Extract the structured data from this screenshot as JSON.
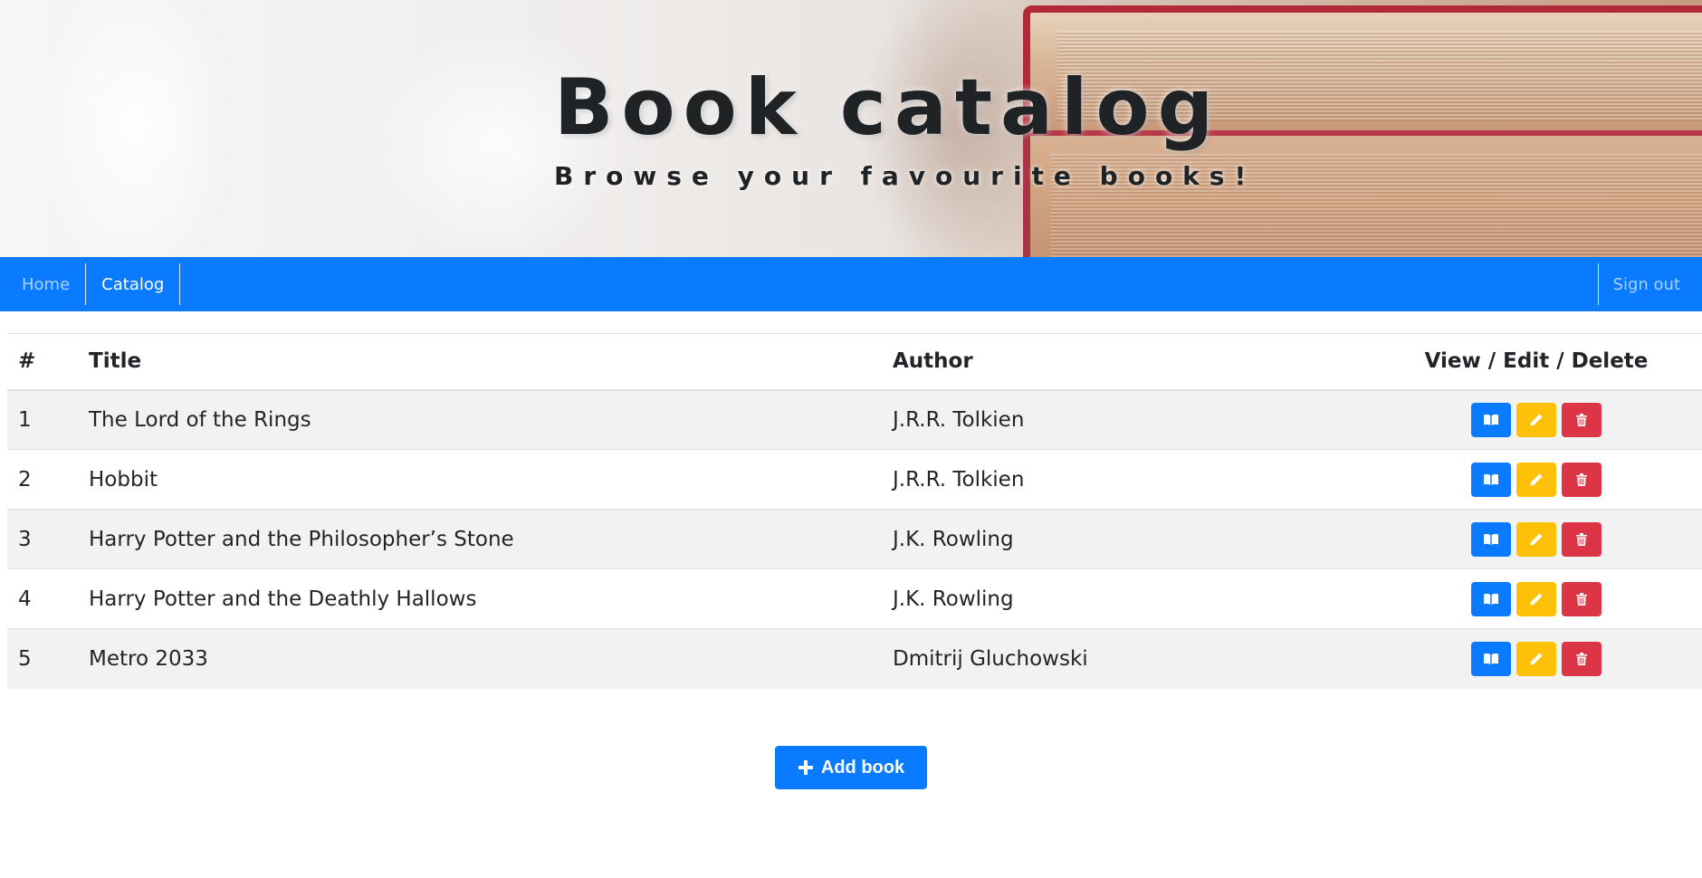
{
  "header": {
    "title": "Book catalog",
    "subtitle": "Browse your favourite books!"
  },
  "nav": {
    "home": "Home",
    "catalog": "Catalog",
    "signout": "Sign out"
  },
  "table": {
    "headers": {
      "num": "#",
      "title": "Title",
      "author": "Author",
      "actions": "View / Edit / Delete"
    },
    "rows": [
      {
        "num": "1",
        "title": "The Lord of the Rings",
        "author": "J.R.R. Tolkien"
      },
      {
        "num": "2",
        "title": "Hobbit",
        "author": "J.R.R. Tolkien"
      },
      {
        "num": "3",
        "title": "Harry Potter and the Philosopher’s Stone",
        "author": "J.K. Rowling"
      },
      {
        "num": "4",
        "title": "Harry Potter and the Deathly Hallows",
        "author": "J.K. Rowling"
      },
      {
        "num": "5",
        "title": "Metro 2033",
        "author": "Dmitrij Gluchowski"
      }
    ]
  },
  "actions": {
    "view_icon": "book-open-icon",
    "edit_icon": "pencil-icon",
    "delete_icon": "trash-icon"
  },
  "add_button": {
    "label": "Add book",
    "icon": "plus-icon"
  },
  "colors": {
    "primary": "#0a7bff",
    "warning": "#ffc107",
    "danger": "#dc3545",
    "stripe": "#f2f2f2"
  }
}
